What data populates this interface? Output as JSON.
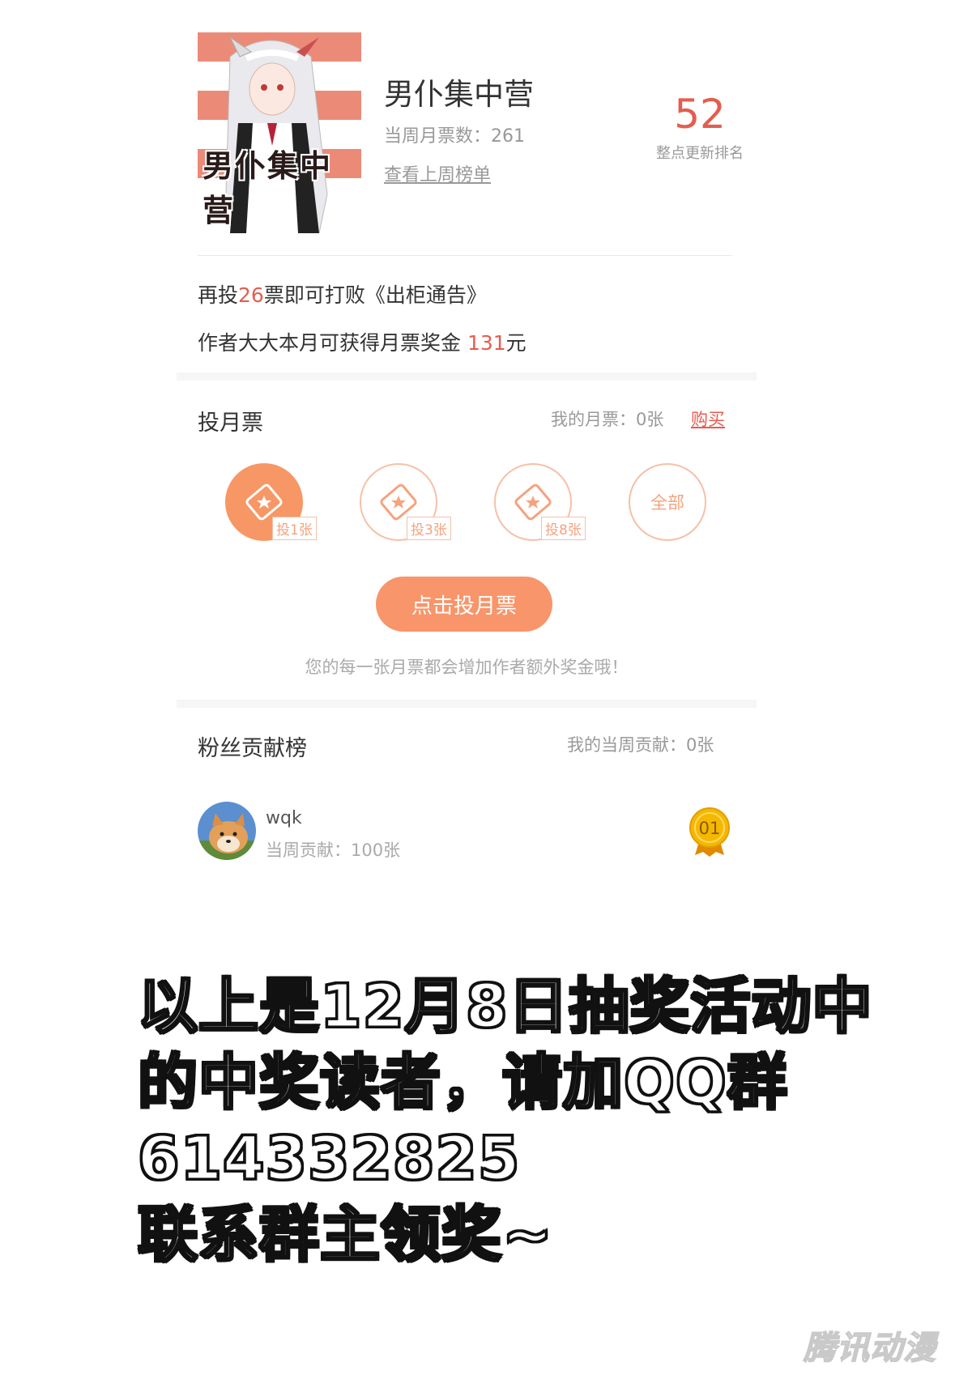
{
  "comic": {
    "cover_title": "男仆集中营",
    "title": "男仆集中营",
    "weekly_votes_label": "当周月票数：261",
    "last_week_link": "查看上周榜单",
    "rank": "52",
    "rank_caption": "整点更新排名"
  },
  "notice": {
    "line1_prefix": "再投",
    "line1_number": "26",
    "line1_suffix": "票即可打败《出柜通告》",
    "line2_prefix": "作者大大本月可获得月票奖金 ",
    "line2_amount": "131",
    "line2_suffix": "元"
  },
  "vote": {
    "title": "投月票",
    "my_tickets": "我的月票：0张",
    "buy_label": "购买",
    "options": [
      {
        "badge": "投1张",
        "selected": true
      },
      {
        "badge": "投3张",
        "selected": false
      },
      {
        "badge": "投8张",
        "selected": false
      }
    ],
    "all_label": "全部",
    "button_label": "点击投月票",
    "hint": "您的每一张月票都会增加作者额外奖金哦！"
  },
  "fans": {
    "title": "粉丝贡献榜",
    "my_contribution": "我的当周贡献：0张",
    "list": [
      {
        "name": "wqk",
        "contribution": "当周贡献：100张",
        "rank": "01"
      }
    ]
  },
  "announcement": {
    "lines": [
      "以上是12月8日抽奖活动中",
      "的中奖读者，请加QQ群",
      "614332825",
      "联系群主领奖~"
    ]
  },
  "watermark": "腾讯动漫",
  "colors": {
    "accent": "#f8956a",
    "highlight": "#e45d4f",
    "cover_stripe": "#ec8a78",
    "medal_gold": "#f5b800"
  },
  "icons": {
    "ticket": "ticket-star-icon",
    "medal": "gold-medal-icon"
  }
}
